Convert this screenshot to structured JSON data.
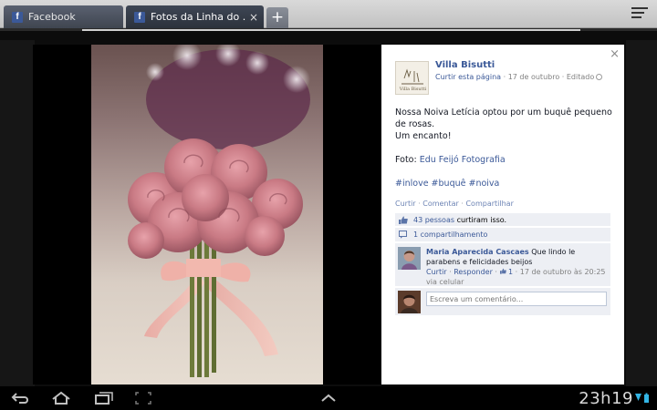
{
  "browser": {
    "tabs": [
      {
        "title": "Facebook",
        "favicon": "facebook-icon",
        "active": false
      },
      {
        "title": "Fotos da Linha do ...",
        "favicon": "facebook-icon",
        "active": true,
        "close_glyph": "×"
      }
    ],
    "new_tab_glyph": "+",
    "load_progress": 0.88
  },
  "post": {
    "close_glyph": "×",
    "page_name": "Villa Bisutti",
    "logo_text": "Villa Bisutti",
    "meta": {
      "like_page": "Curtir esta página",
      "separator": " · ",
      "date": "17 de outubro",
      "edited": "Editado"
    },
    "text_lines": [
      "Nossa Noiva Letícia optou por um buquê pequeno de rosas.",
      "Um encanto!"
    ],
    "photo_credit_label": "Foto:",
    "photo_credit_link": "Edu Feijó Fotografia",
    "hashtags": "#inlove #buquê #noiva",
    "actions": [
      "Curtir",
      "Comentar",
      "Compartilhar"
    ]
  },
  "ufi": {
    "likes_count": "43 pessoas",
    "likes_suffix": " curtiram isso.",
    "shares": "1 compartilhamento",
    "comment": {
      "author": "Maria Aparecida Cascaes",
      "text": "Que lindo le parabens e felicidades beijos",
      "like": "Curtir",
      "reply": "Responder",
      "like_count": "1",
      "timestamp": "17 de outubro às 20:25 via celular"
    },
    "write_placeholder": "Escreva um comentário..."
  },
  "system": {
    "clock": "23h19",
    "nav_icons": [
      "back-icon",
      "home-icon",
      "recent-apps-icon",
      "screenshot-icon",
      "up-arrow-icon"
    ]
  },
  "colors": {
    "facebook_blue": "#3b5998",
    "ufi_background": "#edeff4",
    "photo_rose": "#c97a84"
  }
}
